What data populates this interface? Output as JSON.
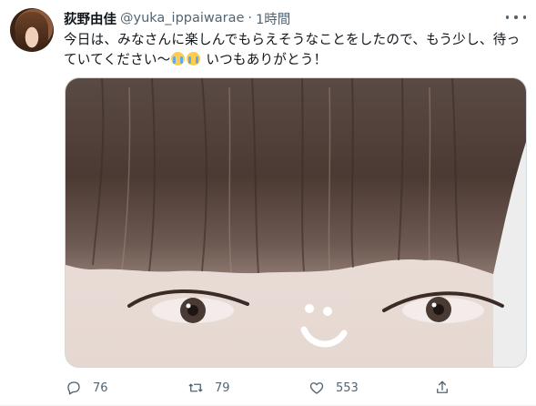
{
  "tweet": {
    "author_name": "荻野由佳",
    "handle": "@yuka_ippaiwarae",
    "separator": "·",
    "time": "1時間",
    "text_part1": "今日は、みなさんに楽しんでもらえそうなことをしたので、もう少し、待っていてください〜",
    "text_emojis": [
      "crying-face",
      "crying-face"
    ],
    "text_part2": " いつもありがとう！",
    "image_alt": "",
    "more_icon": "more-horizontal-icon"
  },
  "actions": {
    "reply_count": "76",
    "retweet_count": "79",
    "like_count": "553",
    "reply_icon": "reply-icon",
    "retweet_icon": "retweet-icon",
    "like_icon": "heart-icon",
    "share_icon": "share-icon"
  },
  "colors": {
    "text": "#0f1419",
    "secondary": "#536471",
    "border": "#cfd9de"
  }
}
